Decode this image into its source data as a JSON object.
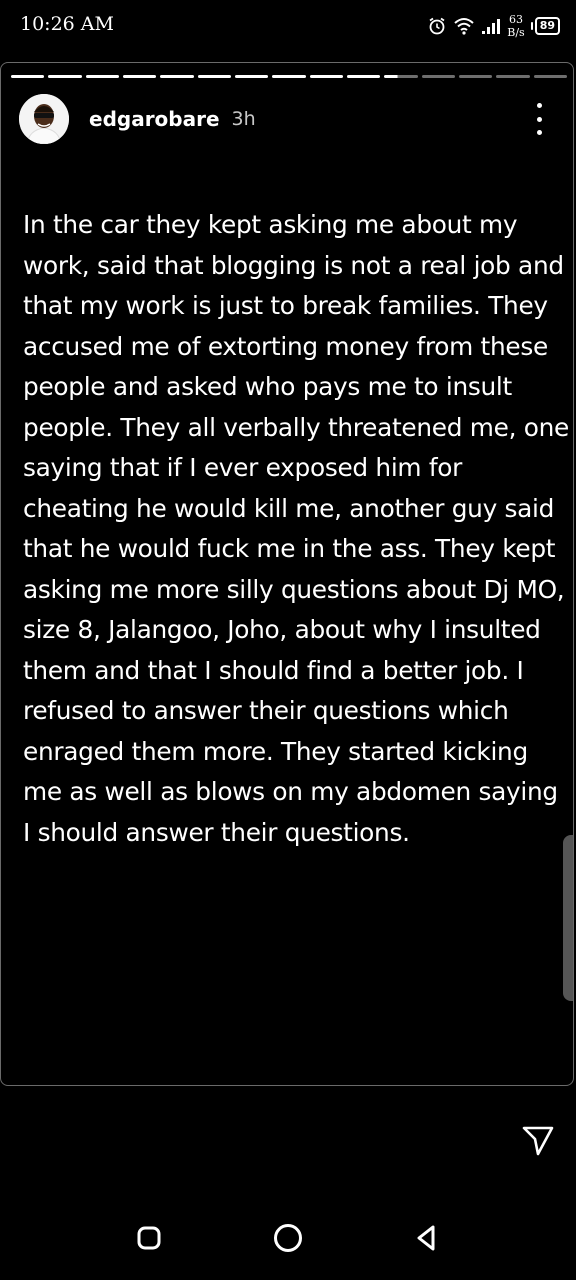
{
  "status_bar": {
    "time": "10:26 AM",
    "net_speed_value": "63",
    "net_speed_unit": "B/s",
    "battery": "89",
    "icons": [
      "alarm-icon",
      "wifi-icon",
      "signal-icon",
      "battery-icon"
    ]
  },
  "story": {
    "progress": {
      "total_segments": 15,
      "completed": 10,
      "current_fraction": 0.4
    },
    "username": "edgarobare",
    "time_ago": "3h",
    "text": "In the car they kept asking me about my work, said that blogging is not a real job and that my work is just to break families. They accused me of extorting money from these people and asked who pays me to insult people. They all verbally threatened me, one saying that if I ever exposed him for cheating he would kill me, another guy said that he would fuck me in the ass. They kept asking me more silly questions about Dj MO, size 8, Jalangoo, Joho, about why I insulted them and that I should find a better job. I refused to answer their questions which enraged them more. They started kicking me as well as blows on my abdomen saying I should answer their questions."
  },
  "nav_bar": {
    "buttons": [
      "recent-apps-button",
      "home-button",
      "back-button"
    ]
  },
  "colors": {
    "background": "#000000",
    "text": "#ffffff",
    "progress_pending": "#6e6e6e",
    "border": "#6a6a6a"
  }
}
